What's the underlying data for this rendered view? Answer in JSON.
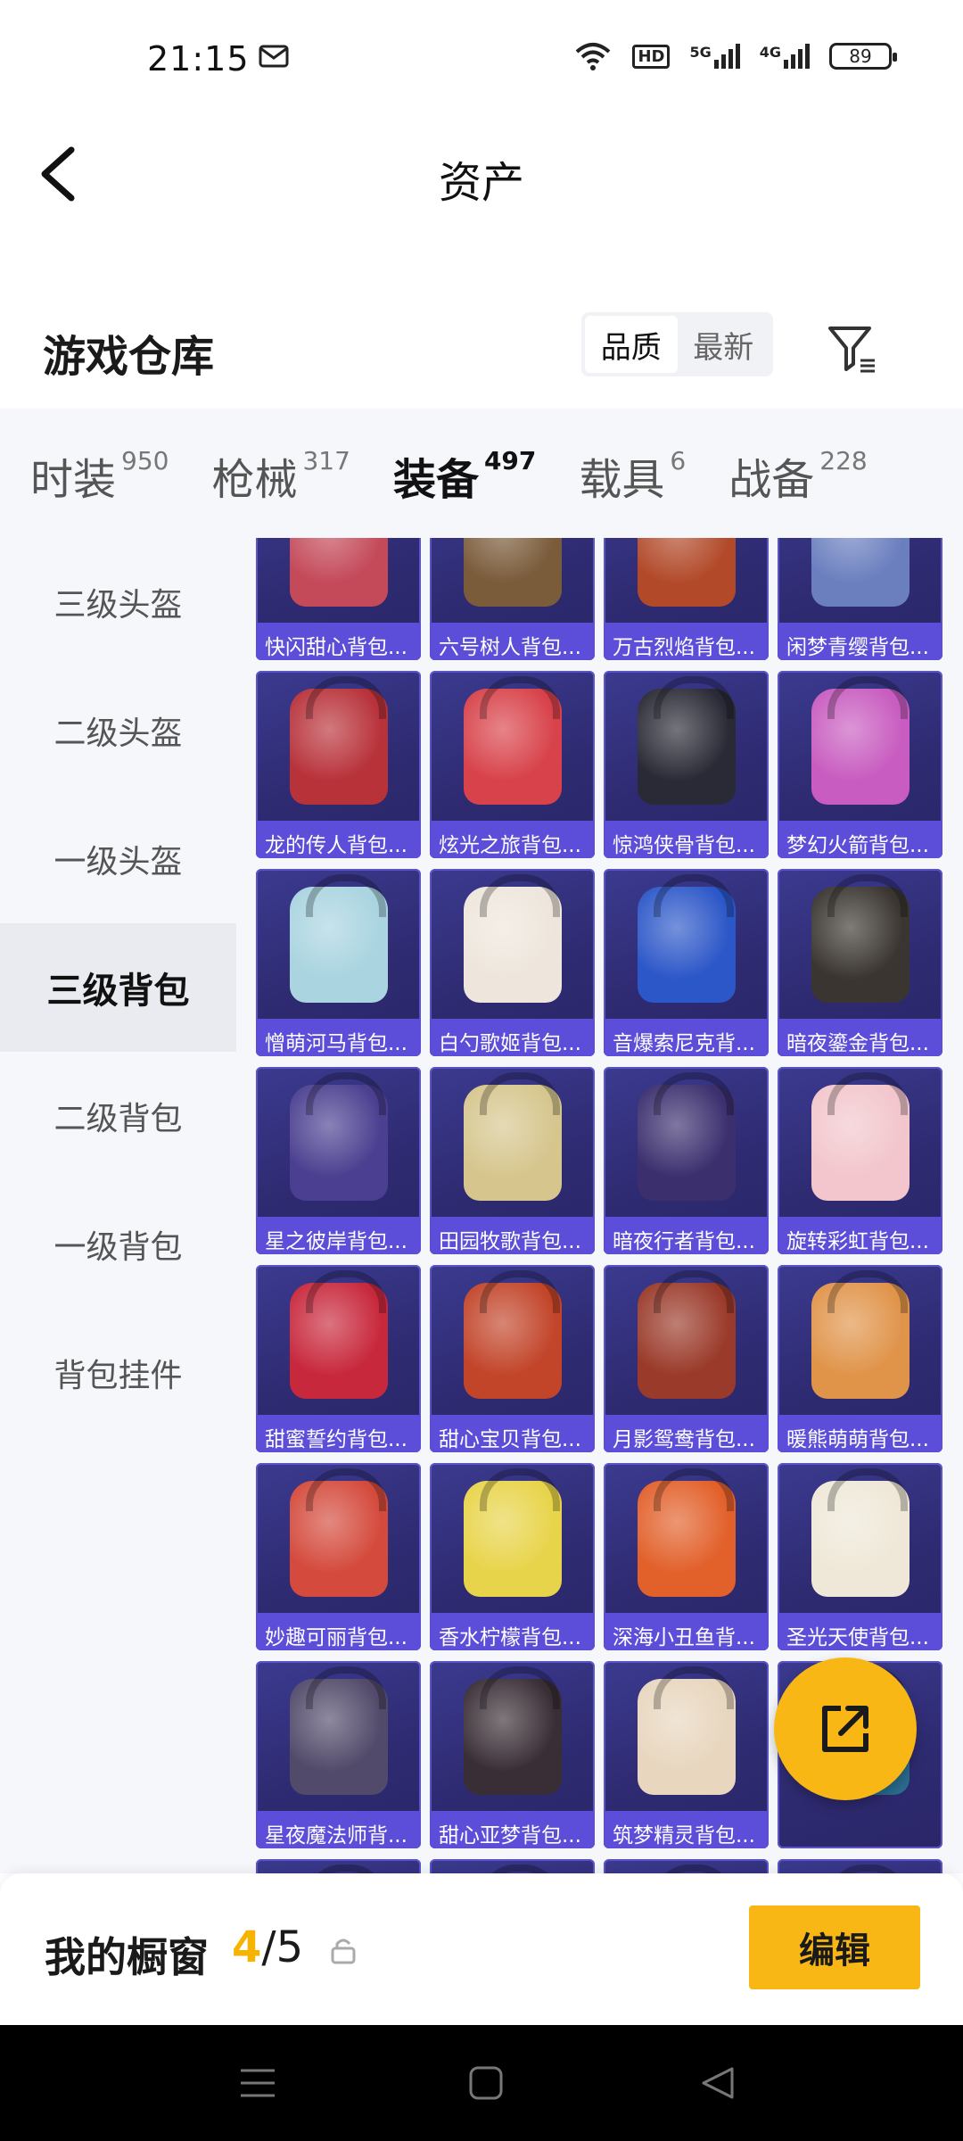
{
  "status": {
    "time": "21:15",
    "network": "HD",
    "sig1": "5G",
    "sig2": "4G",
    "battery": "89"
  },
  "header": {
    "title": "资产"
  },
  "warehouse": {
    "title": "游戏仓库",
    "sort_options": [
      "品质",
      "最新"
    ],
    "sort_selected": "品质"
  },
  "tabs": [
    {
      "label": "时装",
      "count": "950"
    },
    {
      "label": "枪械",
      "count": "317"
    },
    {
      "label": "装备",
      "count": "497"
    },
    {
      "label": "载具",
      "count": "6"
    },
    {
      "label": "战备",
      "count": "228"
    }
  ],
  "side": [
    "三级头盔",
    "二级头盔",
    "一级头盔",
    "三级背包",
    "二级背包",
    "一级背包",
    "背包挂件"
  ],
  "items": [
    {
      "name": "快闪甜心背包...",
      "color": "#c44a5a"
    },
    {
      "name": "六号树人背包...",
      "color": "#7a5b3a"
    },
    {
      "name": "万古烈焰背包...",
      "color": "#b24a2a"
    },
    {
      "name": "闲梦青缨背包...",
      "color": "#6b7fbf"
    },
    {
      "name": "龙的传人背包...",
      "color": "#b8323a"
    },
    {
      "name": "炫光之旅背包...",
      "color": "#d8424a"
    },
    {
      "name": "惊鸿侠骨背包...",
      "color": "#2a2a36"
    },
    {
      "name": "梦幻火箭背包...",
      "color": "#c85cc0"
    },
    {
      "name": "憎萌河马背包...",
      "color": "#a9d4e0"
    },
    {
      "name": "白勺歌姬背包...",
      "color": "#eee6dc"
    },
    {
      "name": "音爆索尼克背...",
      "color": "#2c57c8"
    },
    {
      "name": "暗夜鎏金背包...",
      "color": "#3a3530"
    },
    {
      "name": "星之彼岸背包...",
      "color": "#4a3f90"
    },
    {
      "name": "田园牧歌背包...",
      "color": "#d6c68e"
    },
    {
      "name": "暗夜行者背包...",
      "color": "#3b2f6e"
    },
    {
      "name": "旋转彩虹背包...",
      "color": "#f2c6cc"
    },
    {
      "name": "甜蜜誓约背包...",
      "color": "#c8283c"
    },
    {
      "name": "甜心宝贝背包...",
      "color": "#c2452a"
    },
    {
      "name": "月影鸳鸯背包...",
      "color": "#9a3a2a"
    },
    {
      "name": "暖熊萌萌背包...",
      "color": "#e0944a"
    },
    {
      "name": "妙趣可丽背包...",
      "color": "#d44a3c"
    },
    {
      "name": "香水柠檬背包...",
      "color": "#e8d44a"
    },
    {
      "name": "深海小丑鱼背...",
      "color": "#e2602a"
    },
    {
      "name": "圣光天使背包...",
      "color": "#efe8d8"
    },
    {
      "name": "星夜魔法师背...",
      "color": "#514a6a"
    },
    {
      "name": "甜心亚梦背包...",
      "color": "#3a2e36"
    },
    {
      "name": "筑梦精灵背包...",
      "color": "#e8d6be"
    },
    {
      "name": "",
      "color": "#2a6c8e"
    },
    {
      "name": "",
      "color": "#e6dde6"
    },
    {
      "name": "",
      "color": "#e2b87a"
    },
    {
      "name": "",
      "color": "#e68aa0"
    },
    {
      "name": "",
      "color": "#dfe8ee"
    }
  ],
  "showcase": {
    "label": "我的橱窗",
    "current": "4",
    "total": "/5"
  },
  "edit_button": "编辑",
  "accent": "#f9b715"
}
